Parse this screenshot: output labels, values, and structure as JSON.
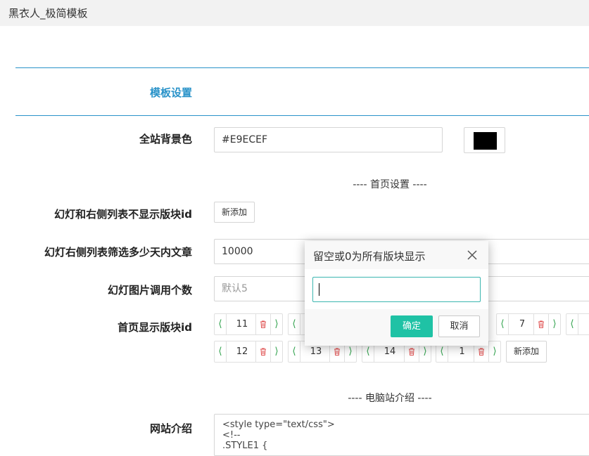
{
  "window": {
    "title": "黑衣人_极简模板"
  },
  "section": {
    "title": "模板设置"
  },
  "bg": {
    "label": "全站背景色",
    "value": "#E9ECEF",
    "swatch_color": "#000000"
  },
  "home": {
    "heading": "---- 首页设置 ----"
  },
  "hide_ids": {
    "label": "幻灯和右侧列表不显示版块id",
    "add_label": "新添加"
  },
  "days": {
    "label": "幻灯右侧列表筛选多少天内文章",
    "value": "10000"
  },
  "slides": {
    "label": "幻灯图片调用个数",
    "placeholder": "默认5"
  },
  "show_ids": {
    "label": "首页显示版块id",
    "row1": [
      "11",
      "7"
    ],
    "row2": [
      "12",
      "13",
      "14",
      "1"
    ],
    "add_label": "新添加"
  },
  "pc": {
    "heading": "---- 电脑站介绍 ----"
  },
  "intro": {
    "label": "网站介绍",
    "value": "<style type=\"text/css\">\n<!--\n.STYLE1 {"
  },
  "dialog": {
    "title": "留空或0为所有版块显示",
    "ok_label": "确定",
    "cancel_label": "取消"
  }
}
